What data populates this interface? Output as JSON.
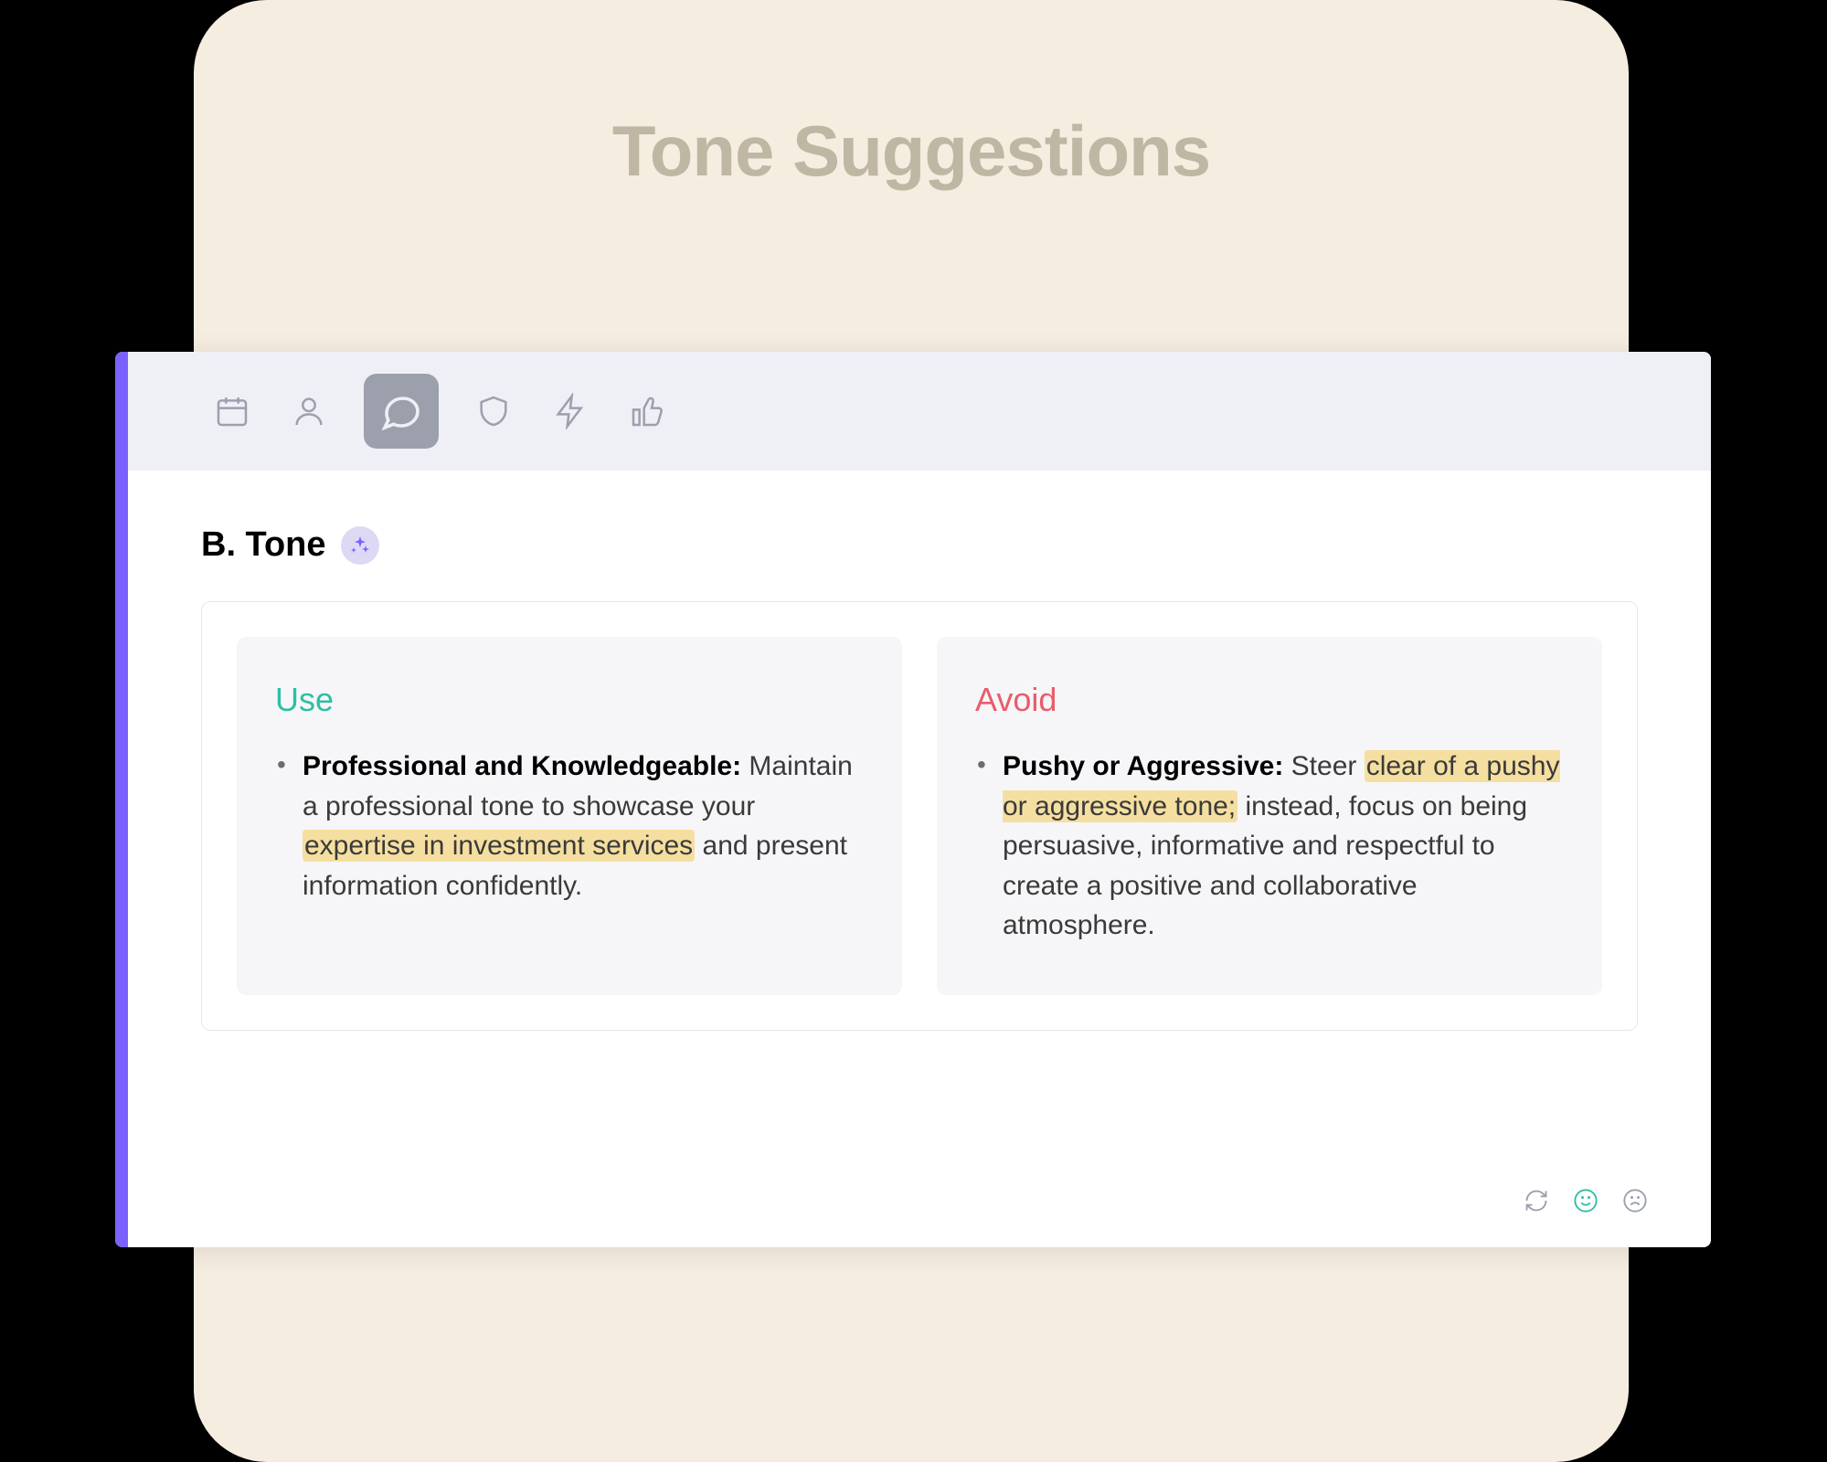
{
  "header": {
    "title": "Tone Suggestions"
  },
  "toolbar": {
    "icons": [
      "calendar",
      "person",
      "chat",
      "shield",
      "bolt",
      "thumbs-up"
    ],
    "active_index": 2
  },
  "section": {
    "label": "B. Tone"
  },
  "panels": {
    "use": {
      "title": "Use",
      "item": {
        "bold": "Professional and Knowledgeable:",
        "pre": " Maintain a professional tone to showcase your ",
        "hl": "expertise in investment services",
        "post": " and present information confidently."
      }
    },
    "avoid": {
      "title": "Avoid",
      "item": {
        "bold": "Pushy or Aggressive:",
        "pre": " Steer ",
        "hl": "clear of a pushy or aggressive tone;",
        "post": " instead, focus on being persuasive, informative and respectful to create a positive and collaborative atmosphere."
      }
    }
  }
}
